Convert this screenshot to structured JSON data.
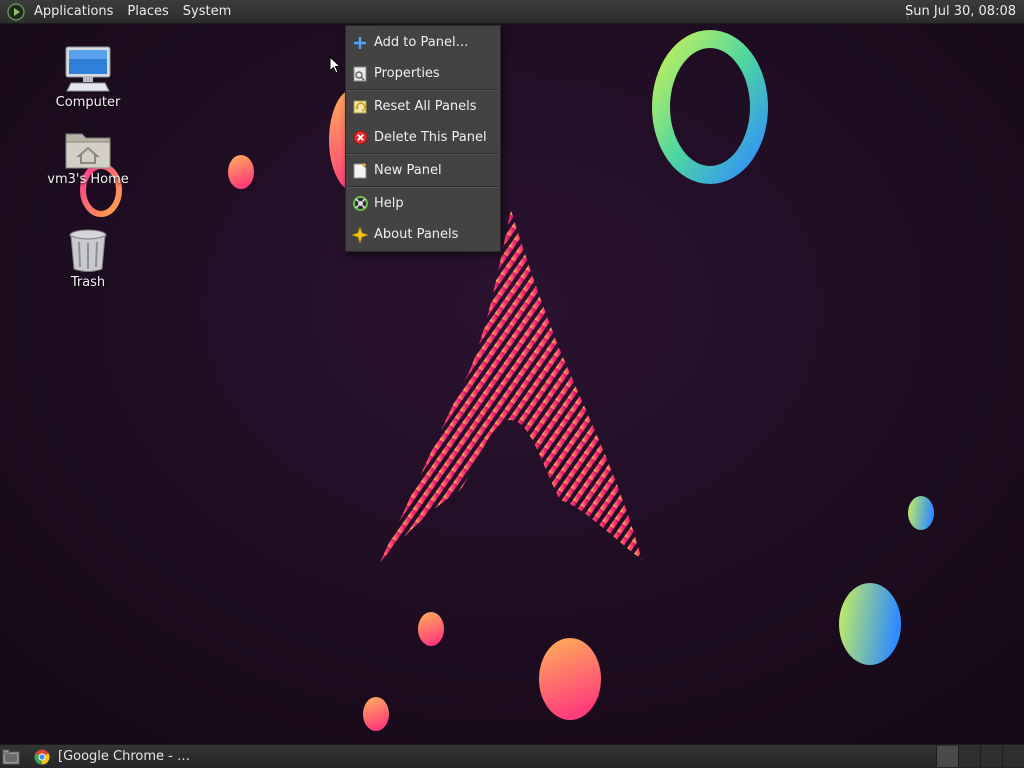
{
  "top_panel": {
    "menus": [
      "Applications",
      "Places",
      "System"
    ],
    "clock": "Sun Jul 30, 08:08"
  },
  "desktop_icons": [
    {
      "label": "Computer",
      "icon": "computer-icon"
    },
    {
      "label": "vm3's Home",
      "icon": "home-folder-icon"
    },
    {
      "label": "Trash",
      "icon": "trash-icon"
    }
  ],
  "context_menu": {
    "items": [
      {
        "label": "Add to Panel…",
        "icon": "plus-icon"
      },
      {
        "label": "Properties",
        "icon": "properties-icon"
      },
      {
        "label": "Reset All Panels",
        "icon": "reset-icon"
      },
      {
        "label": "Delete This Panel",
        "icon": "delete-icon"
      },
      {
        "label": "New Panel",
        "icon": "new-panel-icon"
      },
      {
        "label": "Help",
        "icon": "help-icon"
      },
      {
        "label": "About Panels",
        "icon": "about-icon"
      }
    ]
  },
  "bottom_panel": {
    "task_label": "[Google Chrome - …"
  },
  "colors": {
    "panel": "#2c2c2c",
    "menu_bg": "#434343",
    "wallpaper": "#1b0c1e",
    "accent_pink": "#e0206e",
    "accent_orange": "#ff9a3c"
  }
}
